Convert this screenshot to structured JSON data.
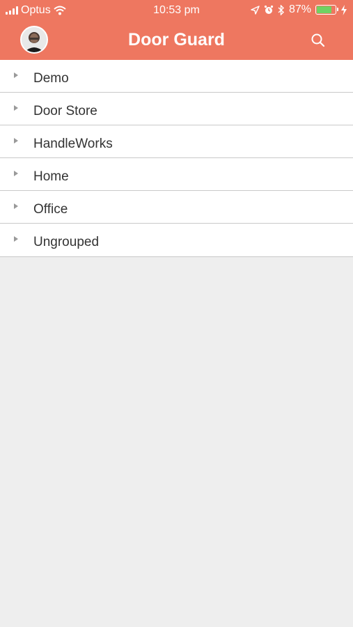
{
  "status_bar": {
    "carrier": "Optus",
    "time": "10:53 pm",
    "battery_percent": "87%",
    "battery_level": 0.87
  },
  "header": {
    "title": "Door Guard",
    "avatar_icon": "user-avatar",
    "search_icon": "search-icon"
  },
  "groups": [
    {
      "label": "Demo"
    },
    {
      "label": "Door Store"
    },
    {
      "label": "HandleWorks"
    },
    {
      "label": "Home"
    },
    {
      "label": "Office"
    },
    {
      "label": "Ungrouped"
    }
  ],
  "colors": {
    "header": "#ee7760",
    "background": "#eeeeee",
    "battery_fill": "#6fd263"
  }
}
